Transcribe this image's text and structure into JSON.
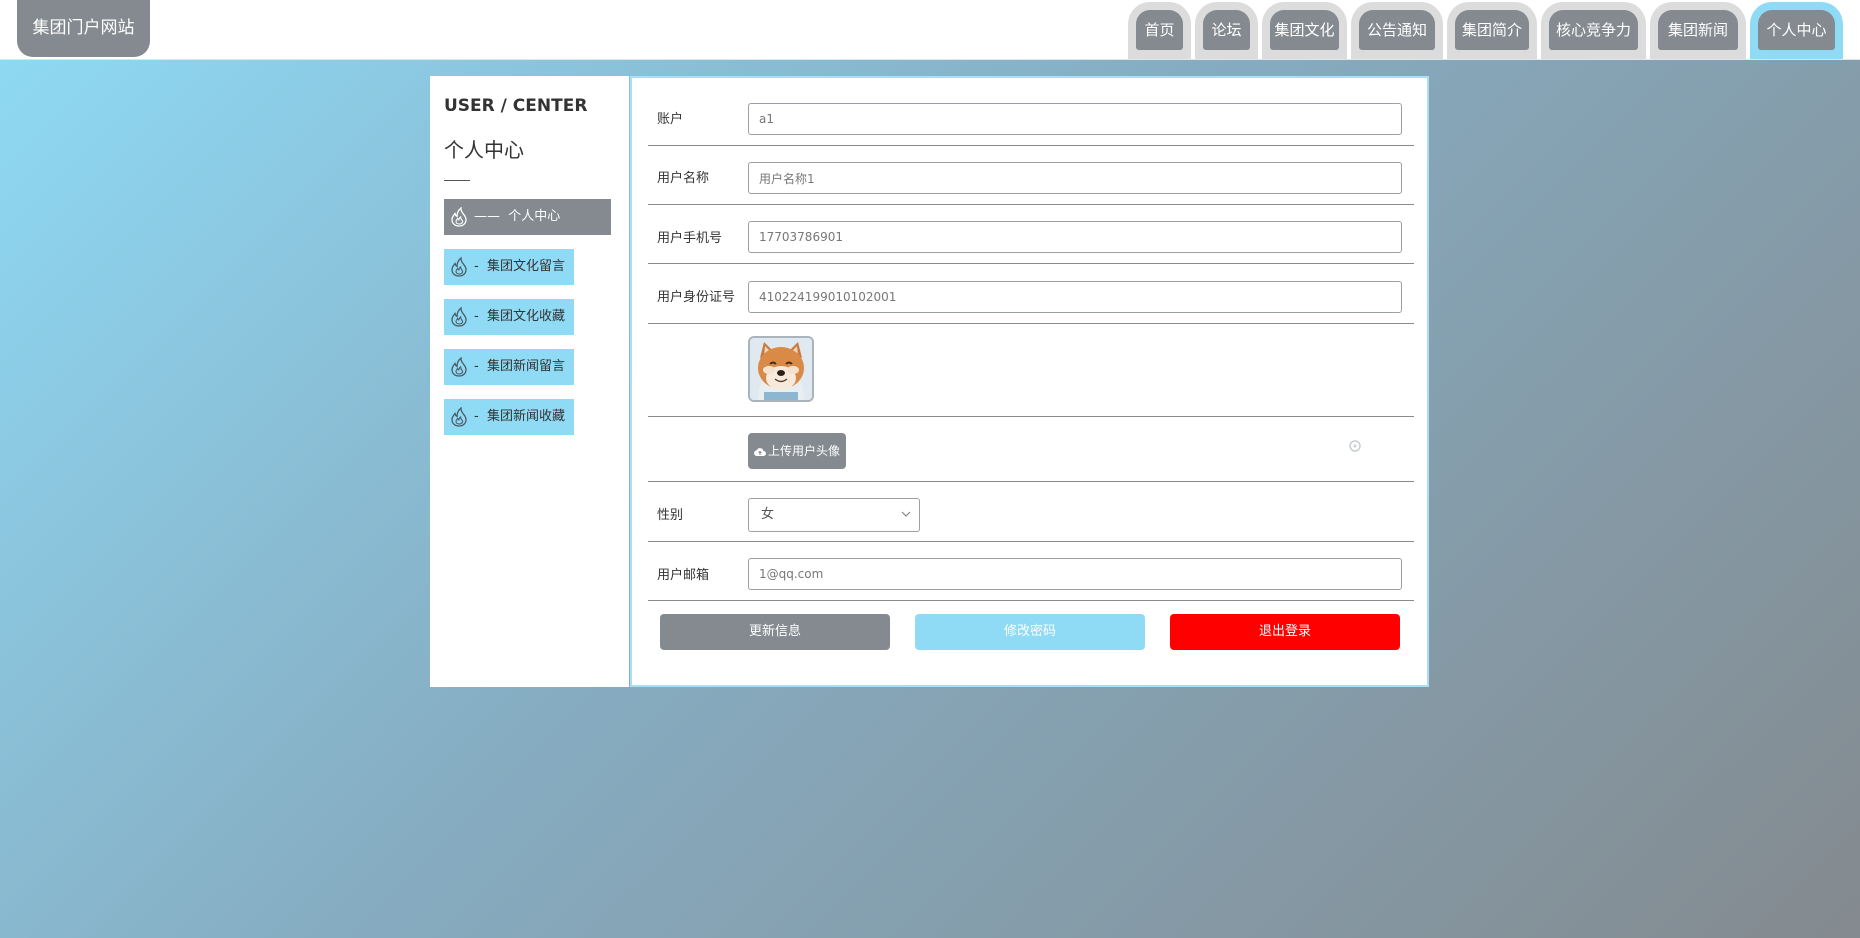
{
  "app": {
    "title": "集团门户网站"
  },
  "nav": {
    "items": [
      {
        "label": "首页"
      },
      {
        "label": "论坛"
      },
      {
        "label": "集团文化"
      },
      {
        "label": "公告通知"
      },
      {
        "label": "集团简介"
      },
      {
        "label": "核心竞争力"
      },
      {
        "label": "集团新闻"
      },
      {
        "label": "个人中心",
        "active": true
      }
    ]
  },
  "sidebar": {
    "title": "USER / CENTER",
    "subtitle": "个人中心",
    "items": [
      {
        "prefix": "——",
        "label": "个人中心",
        "active": true,
        "icon": "flame-icon"
      },
      {
        "prefix": "-",
        "label": "集团文化留言",
        "icon": "flame-icon"
      },
      {
        "prefix": "-",
        "label": "集团文化收藏",
        "icon": "flame-icon"
      },
      {
        "prefix": "-",
        "label": "集团新闻留言",
        "icon": "flame-icon"
      },
      {
        "prefix": "-",
        "label": "集团新闻收藏",
        "icon": "flame-icon"
      }
    ]
  },
  "form": {
    "account": {
      "label": "账户",
      "value": "a1"
    },
    "username": {
      "label": "用户名称",
      "value": "用户名称1"
    },
    "phone": {
      "label": "用户手机号",
      "value": "17703786901"
    },
    "id_card": {
      "label": "用户身份证号",
      "value": "410224199010102001"
    },
    "avatar": {
      "alt": "avatar"
    },
    "upload": {
      "label": "上传用户头像",
      "icon": "cloud-upload-icon"
    },
    "gender": {
      "label": "性别",
      "value": "女"
    },
    "email": {
      "label": "用户邮箱",
      "value": "1@qq.com"
    }
  },
  "actions": {
    "update_label": "更新信息",
    "change_password_label": "修改密码",
    "logout_label": "退出登录"
  },
  "colors": {
    "primary": "#848a8f",
    "accent": "#8fdbf6",
    "danger": "#ff0000"
  }
}
